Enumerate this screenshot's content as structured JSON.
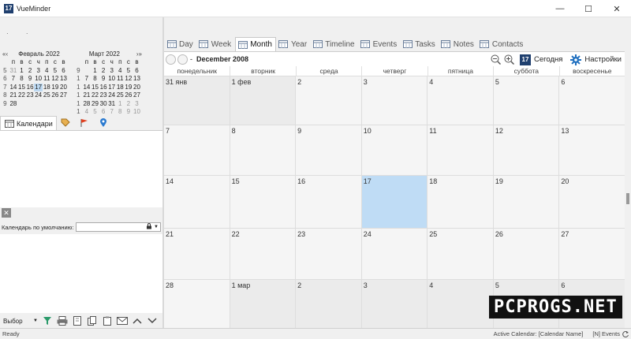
{
  "window": {
    "title": "VueMinder",
    "icon_text": "17"
  },
  "mini_calendars": [
    {
      "title": "Февраль 2022",
      "nav_prev": "«‹",
      "nav_next": "",
      "weekday_headers": [
        "",
        "п",
        "в",
        "с",
        "ч",
        "п",
        "с",
        "в"
      ],
      "weeks": [
        [
          "5",
          "31",
          "1",
          "2",
          "3",
          "4",
          "5",
          "6"
        ],
        [
          "6",
          "7",
          "8",
          "9",
          "10",
          "11",
          "12",
          "13"
        ],
        [
          "7",
          "14",
          "15",
          "16",
          "17",
          "18",
          "19",
          "20"
        ],
        [
          "8",
          "21",
          "22",
          "23",
          "24",
          "25",
          "26",
          "27"
        ],
        [
          "9",
          "28",
          "",
          "",
          "",
          "",
          "",
          ""
        ]
      ],
      "today": "17"
    },
    {
      "title": "Март 2022",
      "nav_prev": "",
      "nav_next": "›»",
      "weekday_headers": [
        "",
        "п",
        "в",
        "с",
        "ч",
        "п",
        "с",
        "в"
      ],
      "weeks": [
        [
          "9",
          "",
          "1",
          "2",
          "3",
          "4",
          "5",
          "6"
        ],
        [
          "1",
          "7",
          "8",
          "9",
          "10",
          "11",
          "12",
          "13"
        ],
        [
          "1",
          "14",
          "15",
          "16",
          "17",
          "18",
          "19",
          "20"
        ],
        [
          "1",
          "21",
          "22",
          "23",
          "24",
          "25",
          "26",
          "27"
        ],
        [
          "1",
          "28",
          "29",
          "30",
          "31",
          "1",
          "2",
          "3"
        ],
        [
          "1",
          "4",
          "5",
          "6",
          "7",
          "8",
          "9",
          "10"
        ]
      ]
    }
  ],
  "left_tabs": {
    "calendars": "Календари"
  },
  "default_calendar_label": "Календарь по умолчанию:",
  "left_bottom": {
    "select_label": "Выбор"
  },
  "view_tabs": [
    {
      "label": "Day",
      "icon": "day-icon"
    },
    {
      "label": "Week",
      "icon": "week-icon"
    },
    {
      "label": "Month",
      "icon": "month-icon",
      "active": true
    },
    {
      "label": "Year",
      "icon": "year-icon"
    },
    {
      "label": "Timeline",
      "icon": "timeline-icon"
    },
    {
      "label": "Events",
      "icon": "events-icon"
    },
    {
      "label": "Tasks",
      "icon": "tasks-icon"
    },
    {
      "label": "Notes",
      "icon": "notes-icon"
    },
    {
      "label": "Contacts",
      "icon": "contacts-icon"
    }
  ],
  "calendar_header": {
    "dash": "-",
    "title": "December 2008",
    "today_icon_text": "17",
    "today_label": "Сегодня",
    "settings_label": "Настройки"
  },
  "weekdays": [
    "понедельник",
    "вторник",
    "среда",
    "четверг",
    "пятница",
    "суббота",
    "воскресенье"
  ],
  "month_cells": [
    {
      "label": "31 янв",
      "kind": "prev"
    },
    {
      "label": "1 фев",
      "kind": "prev"
    },
    {
      "label": "2",
      "kind": "cur"
    },
    {
      "label": "3",
      "kind": "cur"
    },
    {
      "label": "4",
      "kind": "cur"
    },
    {
      "label": "5",
      "kind": "cur"
    },
    {
      "label": "6",
      "kind": "cur"
    },
    {
      "label": "7",
      "kind": "cur"
    },
    {
      "label": "8",
      "kind": "cur"
    },
    {
      "label": "9",
      "kind": "cur"
    },
    {
      "label": "10",
      "kind": "cur"
    },
    {
      "label": "11",
      "kind": "cur"
    },
    {
      "label": "12",
      "kind": "cur"
    },
    {
      "label": "13",
      "kind": "cur"
    },
    {
      "label": "14",
      "kind": "cur"
    },
    {
      "label": "15",
      "kind": "cur"
    },
    {
      "label": "16",
      "kind": "cur"
    },
    {
      "label": "17",
      "kind": "today"
    },
    {
      "label": "18",
      "kind": "cur"
    },
    {
      "label": "19",
      "kind": "cur"
    },
    {
      "label": "20",
      "kind": "cur"
    },
    {
      "label": "21",
      "kind": "cur"
    },
    {
      "label": "22",
      "kind": "cur"
    },
    {
      "label": "23",
      "kind": "cur"
    },
    {
      "label": "24",
      "kind": "cur"
    },
    {
      "label": "25",
      "kind": "cur"
    },
    {
      "label": "26",
      "kind": "cur"
    },
    {
      "label": "27",
      "kind": "cur"
    },
    {
      "label": "28",
      "kind": "cur"
    },
    {
      "label": "1 мар",
      "kind": "next"
    },
    {
      "label": "2",
      "kind": "next"
    },
    {
      "label": "3",
      "kind": "next"
    },
    {
      "label": "4",
      "kind": "next"
    },
    {
      "label": "5",
      "kind": "next"
    },
    {
      "label": "6",
      "kind": "next"
    }
  ],
  "status": {
    "left": "Ready",
    "active_calendar": "Active Calendar: [Calendar Name]",
    "events": "[N] Events"
  },
  "watermark": "PCPROGS.NET",
  "colors": {
    "accent": "#1f3f6e",
    "today_highlight": "#bfdcf5"
  }
}
